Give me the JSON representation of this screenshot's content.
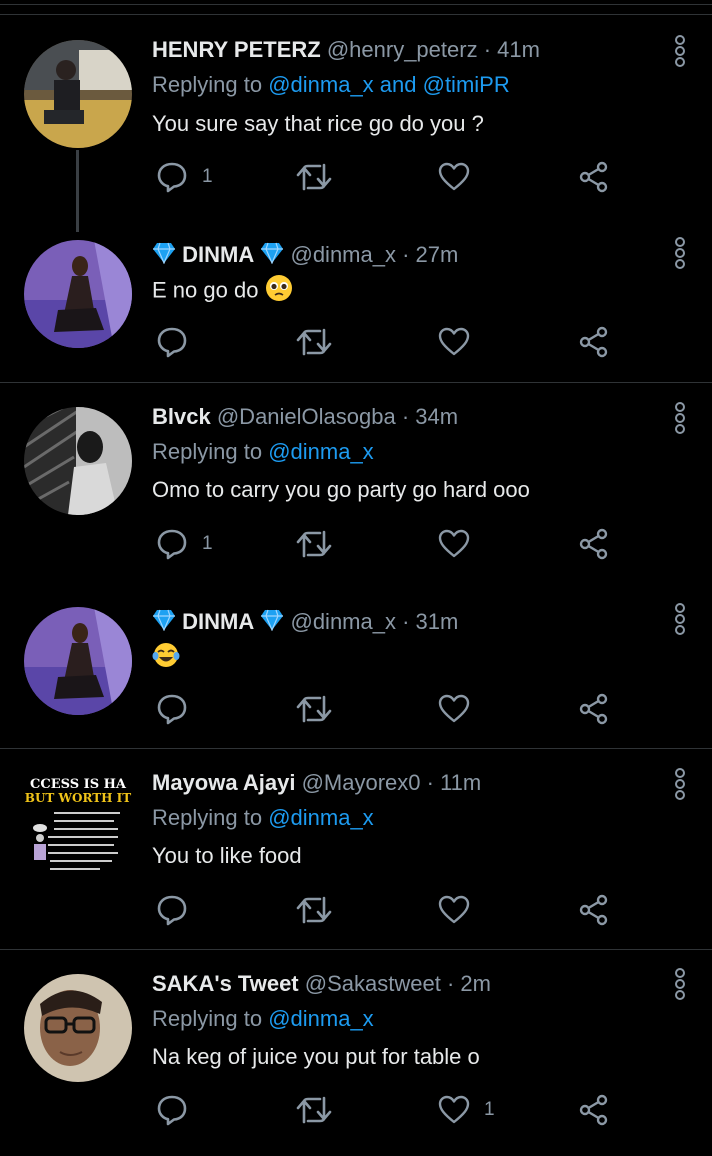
{
  "tweets": [
    {
      "name": "HENRY PETERZ",
      "handle": "@henry_peterz",
      "time": " · 41m",
      "replying_prefix": "Replying to ",
      "replying_to": "@dinma_x and @timiPR",
      "text": "You sure say that rice go do you ?",
      "reply_count": "1",
      "like_count": "",
      "avatar": "photo of man in car interior"
    },
    {
      "name": "DINMA",
      "handle": "@dinma_x",
      "time": " · 27m",
      "text": "E no go do",
      "emoji": "pleading-face",
      "reply_count": "",
      "like_count": "",
      "avatar": "photo of woman by pool"
    },
    {
      "name": "Blvck",
      "handle": "@DanielOlasogba",
      "time": " · 34m",
      "replying_prefix": "Replying to ",
      "replying_to": "@dinma_x",
      "text": "Omo to carry you go party go hard ooo",
      "reply_count": "1",
      "like_count": "",
      "avatar": "black and white portrait"
    },
    {
      "name": "DINMA",
      "handle": "@dinma_x",
      "time": " · 31m",
      "text": "",
      "emoji": "tears-of-joy",
      "reply_count": "",
      "like_count": "",
      "avatar": "photo of woman by pool"
    },
    {
      "name": "Mayowa Ajayi",
      "handle": "@Mayorex0",
      "time": " · 11m",
      "replying_prefix": "Replying to ",
      "replying_to": "@dinma_x",
      "text": "You to like food",
      "reply_count": "",
      "like_count": "",
      "avatar": "motivational poster"
    },
    {
      "name": "SAKA's Tweet",
      "handle": "@Sakastweet",
      "time": " · 2m",
      "replying_prefix": "Replying to ",
      "replying_to": "@dinma_x",
      "text": "Na keg of juice you put for table o",
      "reply_count": "",
      "like_count": "1",
      "avatar": "photo of man with glasses"
    }
  ],
  "poster": {
    "line1": "CCESS IS HA",
    "line2": "BUT WORTH IT"
  },
  "icons": {
    "reply": "reply-icon",
    "retweet": "retweet-icon",
    "like": "like-icon",
    "share": "share-icon",
    "more": "more-icon",
    "diamond": "diamond-icon"
  },
  "colors": {
    "background": "#000000",
    "accent": "#1d9bf0",
    "muted": "#8b98a5",
    "diamond": "#1da1f2"
  }
}
